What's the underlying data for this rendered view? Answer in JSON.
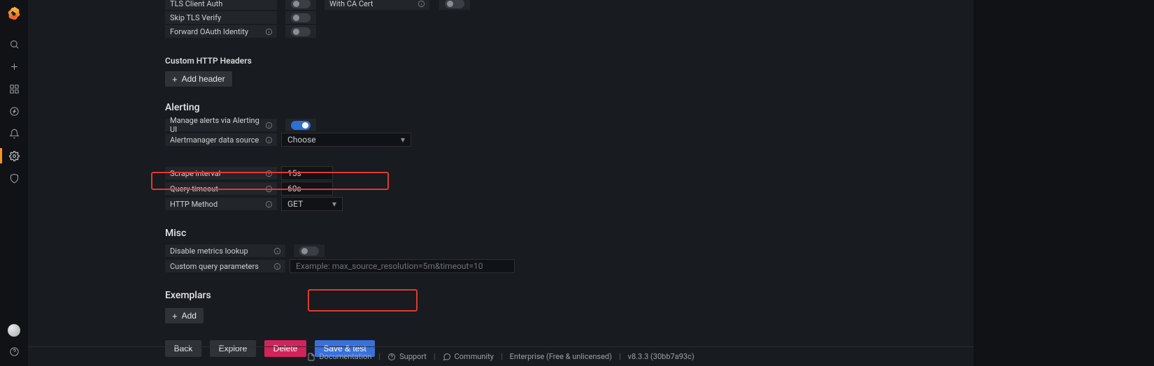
{
  "auth": {
    "tls_client_auth": {
      "label": "TLS Client Auth"
    },
    "with_ca_cert": {
      "label": "With CA Cert"
    },
    "skip_tls_verify": {
      "label": "Skip TLS Verify"
    },
    "forward_oauth": {
      "label": "Forward OAuth Identity"
    }
  },
  "customHeaders": {
    "title": "Custom HTTP Headers",
    "add_button": "Add header"
  },
  "alerting": {
    "title": "Alerting",
    "manage_label": "Manage alerts via Alerting UI",
    "am_ds_label": "Alertmanager data source",
    "am_ds_value": "Choose",
    "scrape_label": "Scrape interval",
    "scrape_value": "15s",
    "qt_label": "Query timeout",
    "qt_value": "60s",
    "http_method_label": "HTTP Method",
    "http_method_value": "GET"
  },
  "misc": {
    "title": "Misc",
    "disable_lookup_label": "Disable metrics lookup",
    "custom_q_label": "Custom query parameters",
    "custom_q_placeholder": "Example: max_source_resolution=5m&timeout=10"
  },
  "exemplars": {
    "title": "Exemplars",
    "add_button": "Add"
  },
  "actions": {
    "back": "Back",
    "explore": "Explore",
    "delete": "Delete",
    "save_test": "Save & test"
  },
  "footer": {
    "documentation": "Documentation",
    "support": "Support",
    "community": "Community",
    "license": "Enterprise (Free & unlicensed)",
    "version": "v8.3.3 (30bb7a93c)"
  }
}
